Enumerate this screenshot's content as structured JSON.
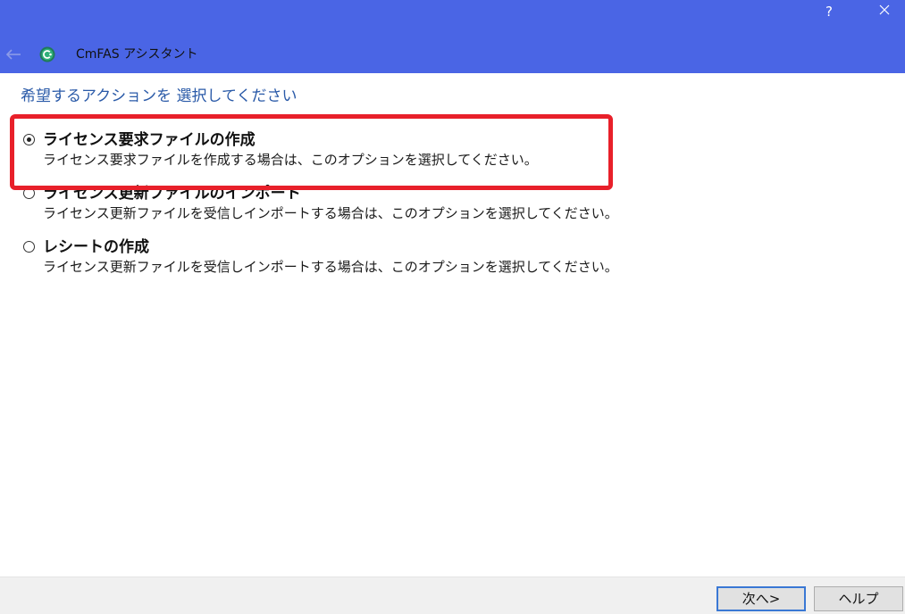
{
  "window": {
    "title": "CmFAS アシスタント",
    "help_label": "?",
    "colors": {
      "titlebar": "#4a65e5",
      "heading": "#2a5aa8",
      "highlight": "#e8202a"
    }
  },
  "icons": {
    "back": "left-arrow-icon",
    "app": "cmfas-logo-icon",
    "close": "close-icon"
  },
  "main": {
    "heading": "希望するアクションを 選択してください",
    "options": [
      {
        "title": "ライセンス要求ファイルの作成",
        "description": "ライセンス要求ファイルを作成する場合は、このオプションを選択してください。",
        "selected": true
      },
      {
        "title": "ライセンス更新ファイルのインポート",
        "description": "ライセンス更新ファイルを受信しインポートする場合は、このオプションを選択してください。",
        "selected": false
      },
      {
        "title": "レシートの作成",
        "description": "ライセンス更新ファイルを受信しインポートする場合は、このオプションを選択してください。",
        "selected": false
      }
    ]
  },
  "footer": {
    "next_label": "次へ>",
    "help_label": "ヘルプ"
  }
}
